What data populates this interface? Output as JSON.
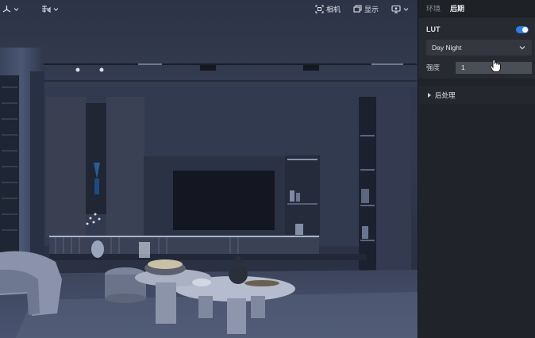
{
  "viewport": {
    "toolbar_left": [
      {
        "name": "view-mode",
        "icon": "axis-gizmo-icon"
      },
      {
        "name": "render-mode",
        "icon": "layers-icon"
      }
    ],
    "toolbar_right": [
      {
        "label": "相机",
        "icon": "camera-focus-icon"
      },
      {
        "label": "显示",
        "icon": "display-icon"
      },
      {
        "label": "",
        "icon": "screen-settings-icon"
      }
    ]
  },
  "panel": {
    "tabs": [
      {
        "label": "环境",
        "active": false
      },
      {
        "label": "后期",
        "active": true
      }
    ],
    "lut": {
      "label": "LUT",
      "enabled": true,
      "selected": "Day Night"
    },
    "strength": {
      "label": "强度",
      "value": "1"
    },
    "post_processing": {
      "label": "后处理"
    }
  },
  "colors": {
    "accent": "#2f7de0",
    "panel_bg": "#202329",
    "scene_tint": "#2f374c"
  }
}
